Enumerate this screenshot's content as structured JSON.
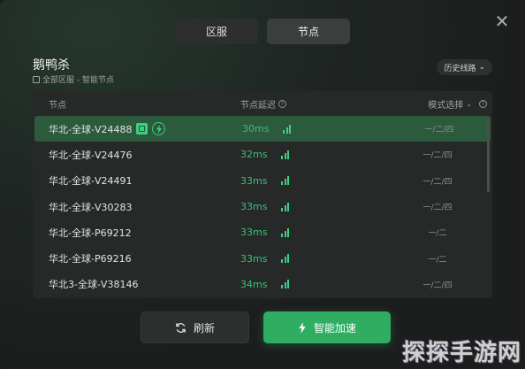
{
  "tabs": [
    {
      "label": "区服",
      "active": false
    },
    {
      "label": "节点",
      "active": true
    }
  ],
  "game": {
    "title": "鹅鸭杀",
    "subtitle": "全部区服 - 智能节点"
  },
  "history_button": "历史线路",
  "table": {
    "headers": {
      "node": "节点",
      "latency": "节点延迟",
      "mode": "模式选择"
    },
    "rows": [
      {
        "name": "华北-全球-V24488",
        "latency": "30ms",
        "mode": "一/二/四",
        "selected": true
      },
      {
        "name": "华北-全球-V24476",
        "latency": "32ms",
        "mode": "一/二/四",
        "selected": false
      },
      {
        "name": "华北-全球-V24491",
        "latency": "33ms",
        "mode": "一/二/四",
        "selected": false
      },
      {
        "name": "华北-全球-V30283",
        "latency": "33ms",
        "mode": "一/二/四",
        "selected": false
      },
      {
        "name": "华北-全球-P69212",
        "latency": "33ms",
        "mode": "一/二",
        "selected": false
      },
      {
        "name": "华北-全球-P69216",
        "latency": "33ms",
        "mode": "一/二",
        "selected": false
      },
      {
        "name": "华北3-全球-V38146",
        "latency": "34ms",
        "mode": "一/二/四",
        "selected": false
      }
    ]
  },
  "buttons": {
    "refresh": "刷新",
    "accelerate": "智能加速"
  },
  "watermark": "探探手游网",
  "colors": {
    "accent_green": "#2fae63",
    "latency_green": "#39c07a",
    "selected_row": "#2b5a3c"
  }
}
